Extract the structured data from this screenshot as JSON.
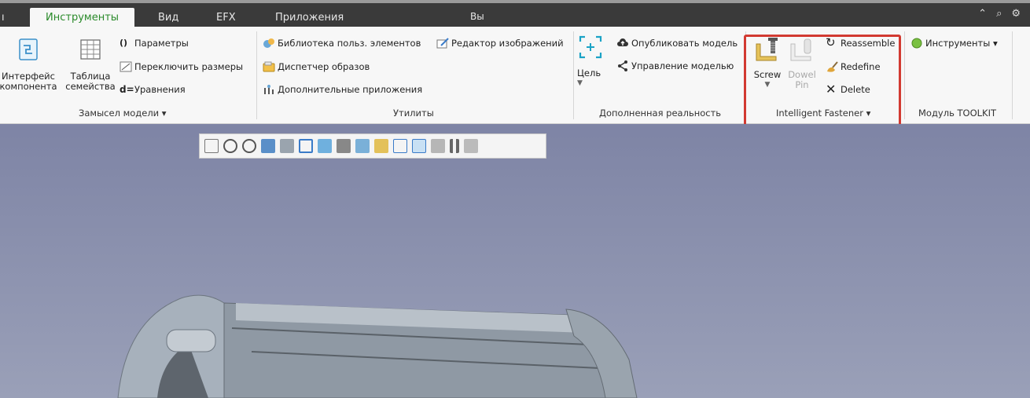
{
  "tabs": [
    {
      "label": "Инструменты",
      "active": true
    },
    {
      "label": "Вид"
    },
    {
      "label": "EFX"
    },
    {
      "label": "Приложения"
    }
  ],
  "user_label": "Вы",
  "groups": {
    "model_intent": {
      "label": "Замысел модели ▾",
      "component_interface": "Интерфейс\nкомпонента",
      "family_table": "Таблица\nсемейства",
      "parameters": "Параметры",
      "switch_dims": "Переключить размеры",
      "relations": "Уравнения"
    },
    "utilities": {
      "label": "Утилиты",
      "udf_library": "Библиотека польз. элементов",
      "image_editor": "Редактор изображений",
      "appearance_manager": "Диспетчер образов",
      "aux_apps": "Дополнительные приложения"
    },
    "ar": {
      "label": "Дополненная реальность",
      "target": "Цель",
      "publish": "Опубликовать модель",
      "manage": "Управление моделью"
    },
    "fastener": {
      "label": "Intelligent Fastener ▾",
      "screw": "Screw",
      "dowel_pin": "Dowel\nPin",
      "reassemble": "Reassemble",
      "redefine": "Redefine",
      "delete": "Delete"
    },
    "toolkit": {
      "label": "Модуль TOOLKIT",
      "tools": "Инструменты ▾"
    }
  },
  "colors": {
    "active_tab_text": "#2a8a2a",
    "highlight_box": "#d23a31",
    "viewport_bg": "#8a8fae"
  }
}
